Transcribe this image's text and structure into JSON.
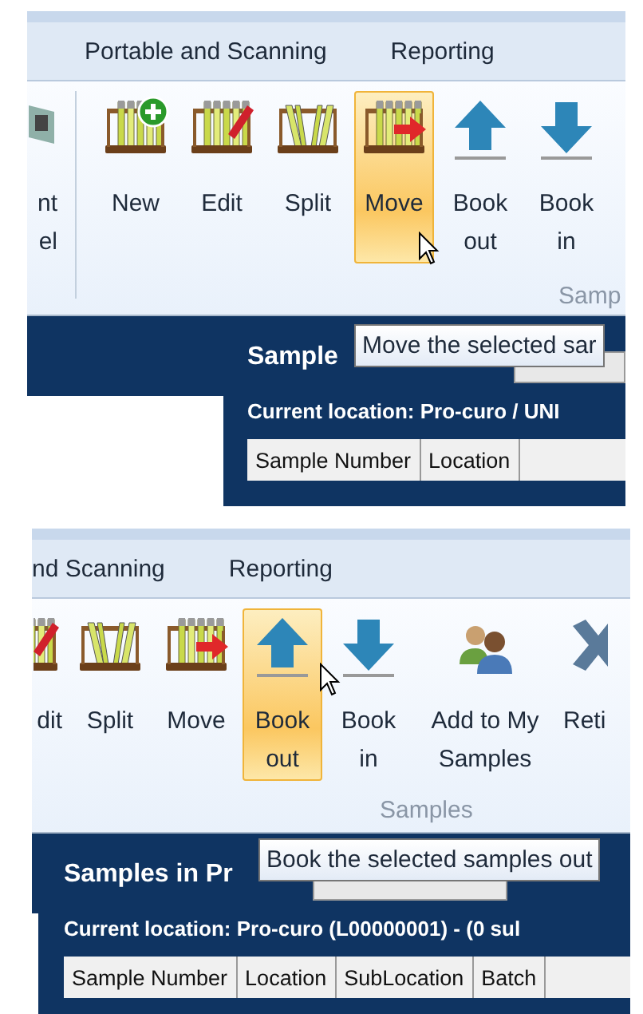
{
  "panels": [
    {
      "tabs": [
        {
          "label": "Portable and Scanning"
        },
        {
          "label": "Reporting"
        }
      ],
      "buttons": [
        {
          "kind": "button",
          "lines": [
            "nt",
            "el"
          ],
          "highlighted": false
        },
        {
          "kind": "separator"
        },
        {
          "kind": "button",
          "lines": [
            "New"
          ],
          "highlighted": false
        },
        {
          "kind": "button",
          "lines": [
            "Edit"
          ],
          "highlighted": false
        },
        {
          "kind": "button",
          "lines": [
            "Split"
          ],
          "highlighted": false
        },
        {
          "kind": "button",
          "lines": [
            "Move"
          ],
          "highlighted": true
        },
        {
          "kind": "button",
          "lines": [
            "Book",
            "out"
          ],
          "highlighted": false
        },
        {
          "kind": "button",
          "lines": [
            "Book",
            "in"
          ],
          "highlighted": false
        }
      ],
      "group_label": "Samp",
      "title": "Sample",
      "location": "Current location: Pro-curo / UNI",
      "columns": [
        "Sample Number",
        "Location"
      ],
      "tooltip": "Move the selected sar"
    },
    {
      "tabs": [
        {
          "label": "nd Scanning"
        },
        {
          "label": "Reporting"
        }
      ],
      "buttons": [
        {
          "kind": "button",
          "lines": [
            "dit"
          ],
          "highlighted": false
        },
        {
          "kind": "button",
          "lines": [
            "Split"
          ],
          "highlighted": false
        },
        {
          "kind": "button",
          "lines": [
            "Move"
          ],
          "highlighted": false
        },
        {
          "kind": "button",
          "lines": [
            "Book",
            "out"
          ],
          "highlighted": true
        },
        {
          "kind": "button",
          "lines": [
            "Book",
            "in"
          ],
          "highlighted": false
        },
        {
          "kind": "button",
          "lines": [
            "Add to My",
            "Samples"
          ],
          "highlighted": false
        },
        {
          "kind": "button",
          "lines": [
            "Reti"
          ],
          "highlighted": false
        }
      ],
      "group_label": "Samples",
      "title": "Samples in Pr",
      "location": "Current location: Pro-curo  (L00000001)  -  (0 sul",
      "columns": [
        "Sample Number",
        "Location",
        "SubLocation",
        "Batch"
      ],
      "tooltip": "Book the selected samples out"
    }
  ]
}
